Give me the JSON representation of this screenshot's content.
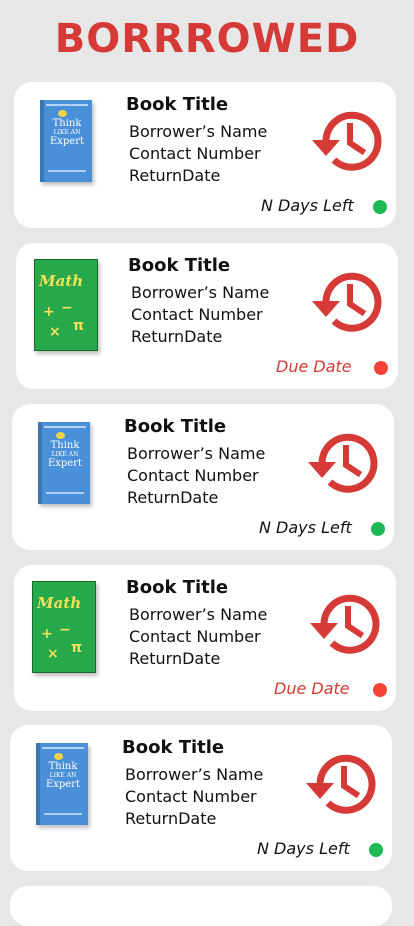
{
  "page": {
    "title": "BORRROWED"
  },
  "colors": {
    "accent": "#d53a36",
    "ok": "#1db954",
    "due": "#f44336"
  },
  "cards": [
    {
      "cover": "think-like-an-expert",
      "book_title": "Book Title",
      "borrower": "Borrower’s Name",
      "contact": "Contact Number",
      "return_date": "ReturnDate",
      "status": "N Days Left",
      "state": "ok"
    },
    {
      "cover": "math",
      "book_title": "Book Title",
      "borrower": "Borrower’s Name",
      "contact": "Contact Number",
      "return_date": "ReturnDate",
      "status": "Due Date",
      "state": "due"
    },
    {
      "cover": "think-like-an-expert",
      "book_title": "Book Title",
      "borrower": "Borrower’s Name",
      "contact": "Contact Number",
      "return_date": "ReturnDate",
      "status": "N Days Left",
      "state": "ok"
    },
    {
      "cover": "math",
      "book_title": "Book Title",
      "borrower": "Borrower’s Name",
      "contact": "Contact Number",
      "return_date": "ReturnDate",
      "status": "Due Date",
      "state": "due"
    },
    {
      "cover": "think-like-an-expert",
      "book_title": "Book Title",
      "borrower": "Borrower’s Name",
      "contact": "Contact Number",
      "return_date": "ReturnDate",
      "status": "N Days Left",
      "state": "ok"
    }
  ],
  "covers": {
    "think": {
      "line1": "Think",
      "line2": "LIKE AN",
      "line3": "Expert"
    },
    "math": {
      "label": "Math"
    }
  },
  "icons": {
    "history": "history-icon",
    "status": "status-dot"
  }
}
